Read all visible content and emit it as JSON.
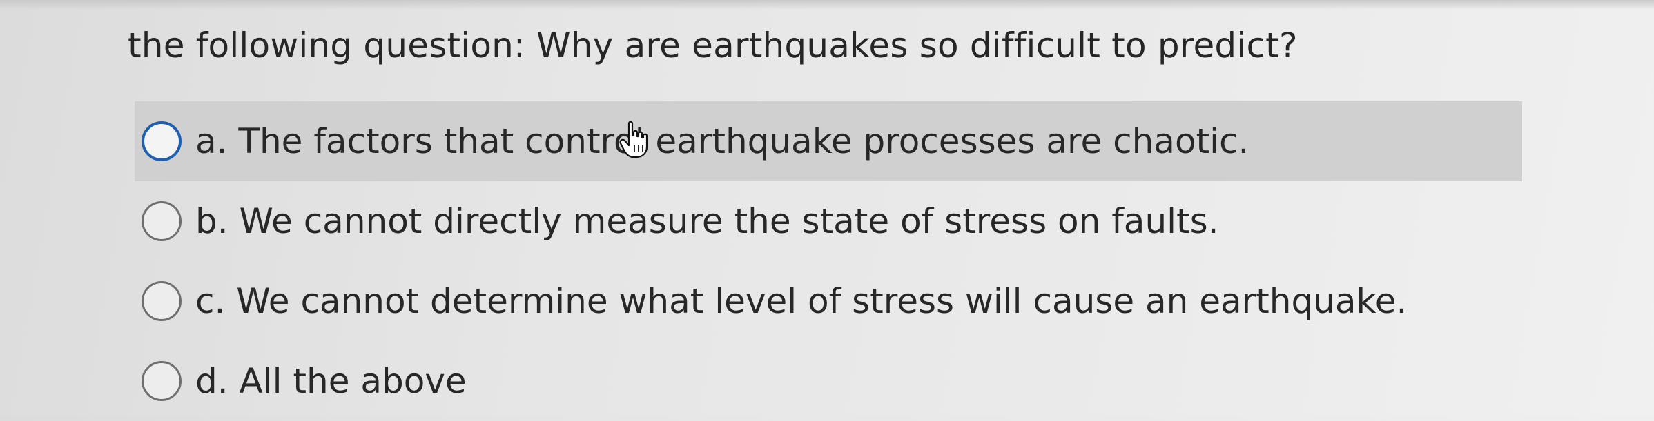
{
  "question": {
    "text": "the following question: Why are earthquakes so difficult to predict?"
  },
  "options": [
    {
      "label": "a. The factors that control earthquake processes are chaotic.",
      "hovered": true
    },
    {
      "label": "b. We cannot directly measure the state of stress on faults.",
      "hovered": false
    },
    {
      "label": "c. We cannot determine what level of stress will cause an earthquake.",
      "hovered": false
    },
    {
      "label": "d. All the above",
      "hovered": false
    }
  ],
  "colors": {
    "hover_row_bg": "#d0d0d0",
    "radio_active_border": "#1f5fb0",
    "radio_border": "#6f6f6f",
    "text": "#272727"
  },
  "icons": {
    "cursor": "hand-pointer-icon",
    "radio": "radio-button-icon"
  }
}
